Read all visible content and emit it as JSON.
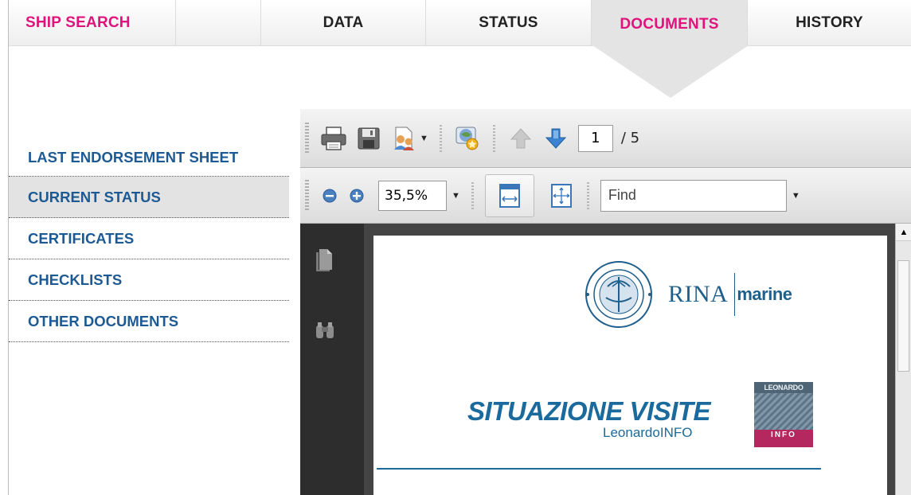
{
  "tabs": [
    {
      "label": "SHIP SEARCH",
      "active": false
    },
    {
      "label": "",
      "active": false
    },
    {
      "label": "DATA",
      "active": false
    },
    {
      "label": "STATUS",
      "active": false
    },
    {
      "label": "DOCUMENTS",
      "active": true
    },
    {
      "label": "HISTORY",
      "active": false
    }
  ],
  "colors": {
    "accent": "#e0137c",
    "link": "#1d5a93",
    "active_tab_bg": "#e4e4e4"
  },
  "sidebar": {
    "items": [
      {
        "label": "LAST ENDORSEMENT SHEET",
        "active": false
      },
      {
        "label": "CURRENT STATUS",
        "active": true
      },
      {
        "label": "CERTIFICATES",
        "active": false
      },
      {
        "label": "CHECKLISTS",
        "active": false
      },
      {
        "label": "OTHER DOCUMENTS",
        "active": false
      }
    ]
  },
  "viewer": {
    "toolbar": {
      "icons": [
        "print-icon",
        "save-icon",
        "share-icon",
        "web-icon",
        "prev-page-icon",
        "next-page-icon"
      ],
      "page_current": "1",
      "page_total": "/ 5",
      "zoom": "35,5%",
      "find_placeholder": "Find"
    },
    "rail_icons": [
      "pages-icon",
      "binoculars-icon"
    ],
    "document": {
      "rina_name": "RINA",
      "rina_suffix": "marine",
      "title": "SITUAZIONE VISITE",
      "subtitle": "LeonardoINFO",
      "leo_logo_top": "LEONARDO",
      "leo_logo_bottom": "INFO"
    }
  }
}
